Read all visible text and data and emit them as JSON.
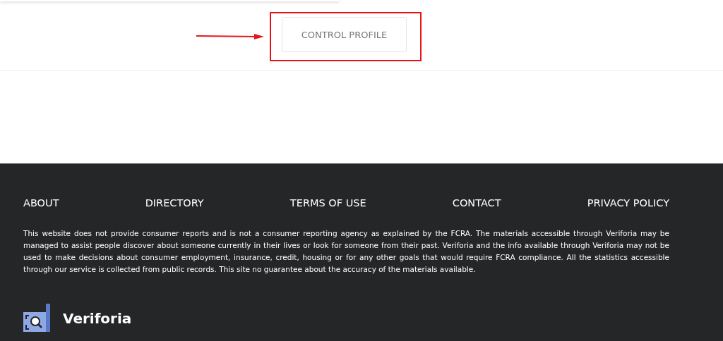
{
  "profile_button": {
    "label": "CONTROL PROFILE"
  },
  "footer": {
    "links": [
      "ABOUT",
      "DIRECTORY",
      "TERMS OF USE",
      "CONTACT",
      "PRIVACY POLICY"
    ],
    "disclaimer": "This website does not provide consumer reports and is not a consumer reporting agency as explained by the FCRA. The materials accessible through Veriforia may be managed to assist people discover about someone currently in their lives or look for someone from their past. Veriforia and the info available through Veriforia may not be used to make decisions about consumer employment, insurance, credit, housing or for any other goals that would require FCRA compliance. All the statistics accessible through our service is collected from public records. This site no guarantee about the accuracy of the materials available.",
    "brand": "Veriforia"
  }
}
